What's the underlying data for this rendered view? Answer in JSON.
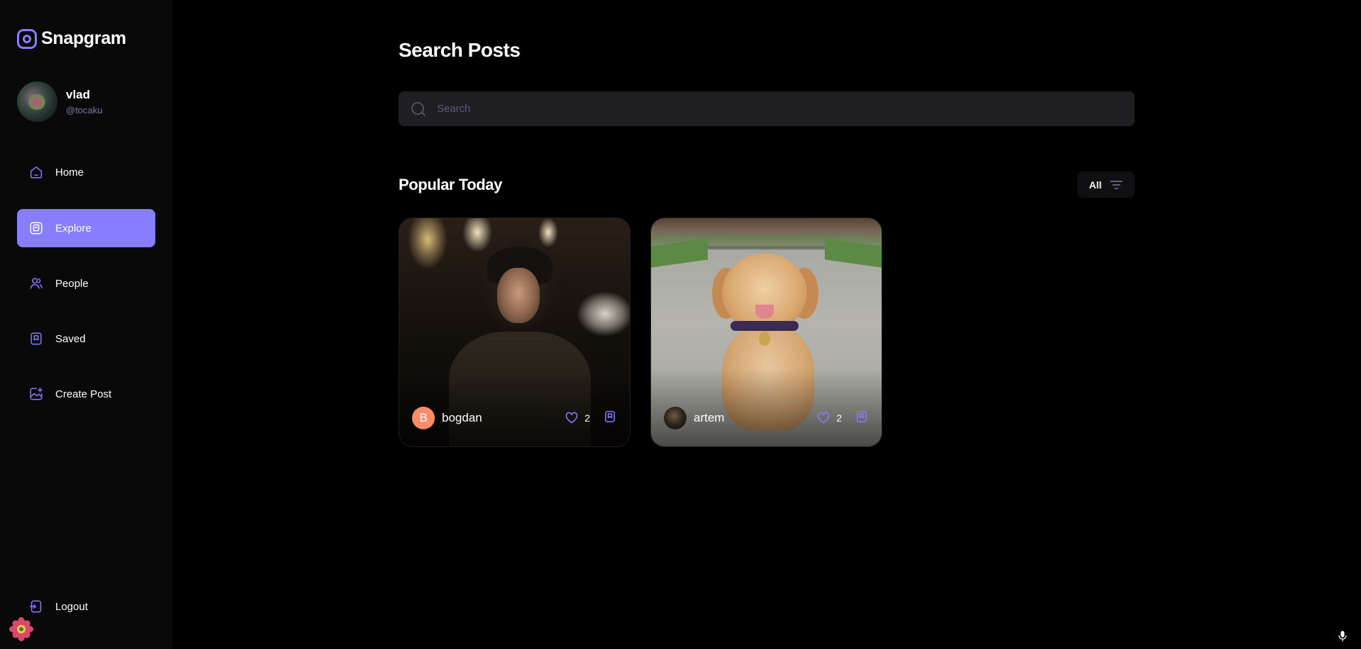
{
  "app": {
    "name": "Snapgram"
  },
  "profile": {
    "name": "vlad",
    "handle": "@tocaku"
  },
  "sidebar": {
    "items": [
      {
        "label": "Home",
        "icon": "home-icon"
      },
      {
        "label": "Explore",
        "icon": "explore-icon",
        "active": true
      },
      {
        "label": "People",
        "icon": "people-icon"
      },
      {
        "label": "Saved",
        "icon": "bookmark-icon"
      },
      {
        "label": "Create Post",
        "icon": "create-post-icon"
      }
    ],
    "logout": {
      "label": "Logout",
      "icon": "logout-icon"
    }
  },
  "main": {
    "title": "Search Posts",
    "search": {
      "placeholder": "Search",
      "value": ""
    },
    "section_title": "Popular Today",
    "filter": {
      "label": "All",
      "icon": "filter-icon"
    },
    "posts": [
      {
        "author": "bogdan",
        "avatar_letter": "B",
        "likes": "2",
        "image": "man-portrait"
      },
      {
        "author": "artem",
        "avatar_letter": "",
        "likes": "2",
        "image": "golden-retriever-puppy"
      }
    ]
  },
  "colors": {
    "accent": "#877eff",
    "background": "#000000",
    "sidebar": "#09090a",
    "search_bg": "#1f1f22",
    "avatar_orange": "#ff8c66"
  }
}
